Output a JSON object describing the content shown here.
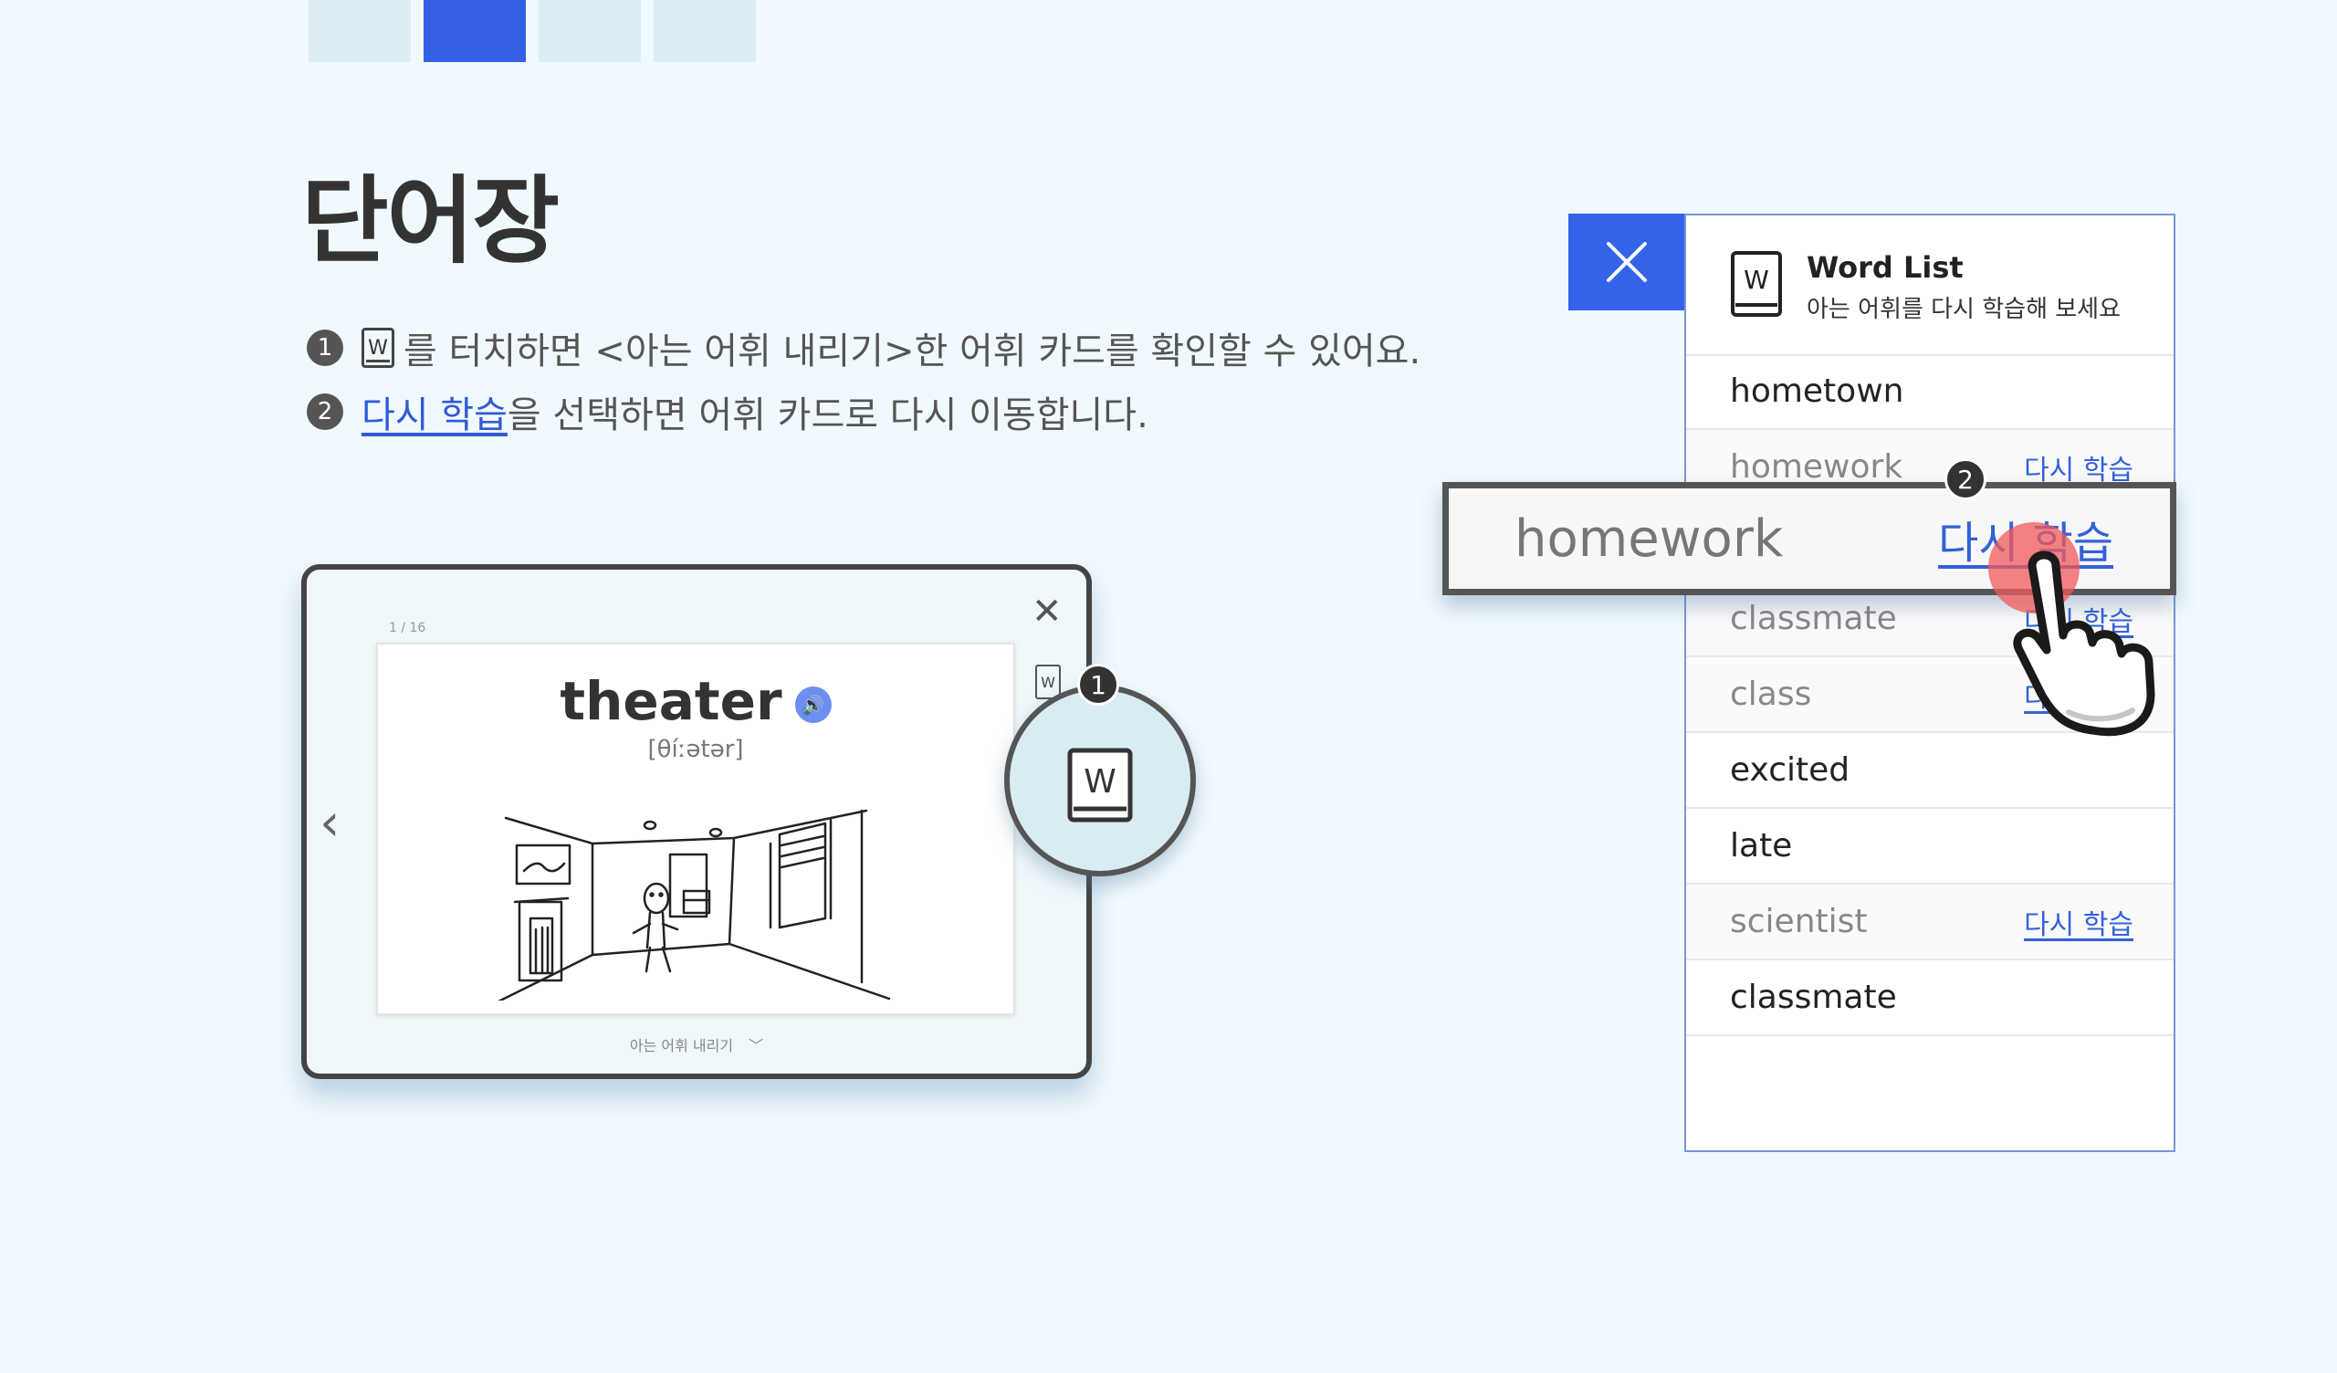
{
  "page_indicator": {
    "count": 4,
    "active_index": 1
  },
  "title": "단어장",
  "instructions": [
    {
      "number": "1",
      "icon": "W",
      "text": "를 터치하면 <아는 어휘 내리기>한 어휘 카드를 확인할 수 있어요."
    },
    {
      "number": "2",
      "link": "다시 학습",
      "text": "을 선택하면 어휘 카드로 다시 이동합니다."
    }
  ],
  "flashcard": {
    "counter": "1 / 16",
    "word": "theater",
    "pronunciation": "[θíːətər]",
    "dismiss_label": "아는 어휘 내리기",
    "w_label": "W",
    "callout_number": "1"
  },
  "word_list": {
    "icon_letter": "W",
    "title": "Word List",
    "subtitle": "아는 어휘를 다시 학습해 보세요",
    "relearn_label": "다시 학습",
    "items": [
      {
        "word": "hometown",
        "known": false
      },
      {
        "word": "homework",
        "known": true
      },
      {
        "word": "scientist",
        "known": false
      },
      {
        "word": "classmate",
        "known": true
      },
      {
        "word": "class",
        "known": true
      },
      {
        "word": "excited",
        "known": false
      },
      {
        "word": "late",
        "known": false
      },
      {
        "word": "scientist",
        "known": true
      },
      {
        "word": "classmate",
        "known": false
      }
    ],
    "zoom": {
      "word": "homework",
      "relearn_label": "다시 학습",
      "callout_number": "2"
    }
  },
  "colors": {
    "accent": "#3462e8",
    "link": "#3361d8",
    "background": "#f0f9fd"
  }
}
